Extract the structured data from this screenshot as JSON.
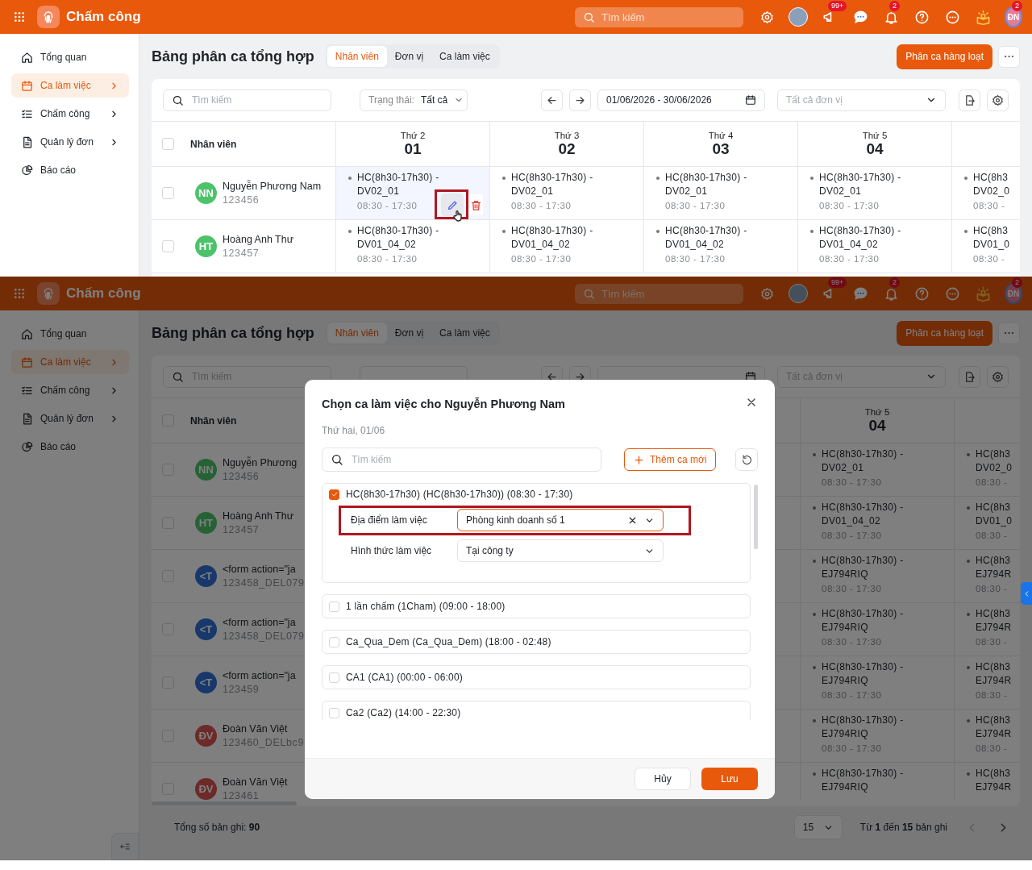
{
  "screens": [
    {
      "header": {
        "app_title": "Chấm công",
        "search_placeholder": "Tìm kiếm",
        "announce_badge": "99+",
        "bell_badge": "2",
        "user_initials": "ĐN",
        "user_badge": "2"
      },
      "sidebar": {
        "items": [
          {
            "label": "Tổng quan",
            "selected": false,
            "submenu": false
          },
          {
            "label": "Ca làm việc",
            "selected": true,
            "submenu": true
          },
          {
            "label": "Chấm công",
            "selected": false,
            "submenu": true
          },
          {
            "label": "Quản lý đơn",
            "selected": false,
            "submenu": true
          },
          {
            "label": "Báo cáo",
            "selected": false,
            "submenu": false
          }
        ]
      },
      "page": {
        "title": "Bảng phân ca tổng hợp",
        "tabs": [
          {
            "label": "Nhân viên",
            "selected": true
          },
          {
            "label": "Đơn vị",
            "selected": false
          },
          {
            "label": "Ca làm việc",
            "selected": false
          }
        ],
        "primary_button": "Phân ca hàng loạt"
      },
      "filters": {
        "search_placeholder": "Tìm kiếm",
        "status_label": "Trạng thái:",
        "status_value": "Tất cả",
        "date_range": "01/06/2026 - 30/06/2026",
        "unit_placeholder": "Tất cả đơn vị"
      },
      "table": {
        "employee_header": "Nhân viên",
        "all_checked": false,
        "day_columns": [
          {
            "weekday": "Thứ 2",
            "date": "01"
          },
          {
            "weekday": "Thứ 3",
            "date": "02"
          },
          {
            "weekday": "Thứ 4",
            "date": "03"
          },
          {
            "weekday": "Thứ 5",
            "date": "04"
          }
        ],
        "rows": [
          {
            "initials": "NN",
            "color": "#4cc36b",
            "checked": false,
            "name": "Nguyễn Phương Nam",
            "code": "123456",
            "shifts": [
              {
                "title": "HC(8h30-17h30) -",
                "unit": "DV02_01",
                "time": "08:30 - 17:30",
                "hovered": true
              },
              {
                "title": "HC(8h30-17h30) -",
                "unit": "DV02_01",
                "time": "08:30 - 17:30",
                "hovered": false
              },
              {
                "title": "HC(8h30-17h30) -",
                "unit": "DV02_01",
                "time": "08:30 - 17:30",
                "hovered": false
              },
              {
                "title": "HC(8h30-17h30) -",
                "unit": "DV02_01",
                "time": "08:30 - 17:30",
                "hovered": false
              },
              {
                "title": "HC(8h3",
                "unit": "DV02_0",
                "time": "08:30 -",
                "hovered": false
              }
            ]
          },
          {
            "initials": "HT",
            "color": "#4cc36b",
            "checked": false,
            "name": "Hoàng Anh Thư",
            "code": "123457",
            "shifts": [
              {
                "title": "HC(8h30-17h30) -",
                "unit": "DV01_04_02",
                "time": "08:30 - 17:30",
                "hovered": false
              },
              {
                "title": "HC(8h30-17h30) -",
                "unit": "DV01_04_02",
                "time": "08:30 - 17:30",
                "hovered": false
              },
              {
                "title": "HC(8h30-17h30) -",
                "unit": "DV01_04_02",
                "time": "08:30 - 17:30",
                "hovered": false
              },
              {
                "title": "HC(8h30-17h30) -",
                "unit": "DV01_04_02",
                "time": "08:30 - 17:30",
                "hovered": false
              },
              {
                "title": "HC(8h3",
                "unit": "DV01_0",
                "time": "08:30 -",
                "hovered": false
              }
            ]
          }
        ]
      }
    },
    {
      "header": {
        "app_title": "Chấm công",
        "search_placeholder": "Tìm kiếm",
        "announce_badge": "99+",
        "bell_badge": "2",
        "user_initials": "ĐN",
        "user_badge": "2"
      },
      "sidebar": {
        "items": [
          {
            "label": "Tổng quan",
            "selected": false,
            "submenu": false
          },
          {
            "label": "Ca làm việc",
            "selected": true,
            "submenu": true
          },
          {
            "label": "Chấm công",
            "selected": false,
            "submenu": true
          },
          {
            "label": "Quản lý đơn",
            "selected": false,
            "submenu": true
          },
          {
            "label": "Báo cáo",
            "selected": false,
            "submenu": false
          }
        ]
      },
      "page": {
        "title": "Bảng phân ca tổng hợp",
        "tabs": [
          {
            "label": "Nhân viên",
            "selected": true
          },
          {
            "label": "Đơn vị",
            "selected": false
          },
          {
            "label": "Ca làm việc",
            "selected": false
          }
        ],
        "primary_button": "Phân ca hàng loạt"
      },
      "filters": {
        "search_placeholder": "Tìm kiếm",
        "unit_placeholder": "Tất cả đơn vị"
      },
      "table": {
        "employee_header": "Nhân viên",
        "all_checked": false,
        "day_columns": [
          {
            "weekday": "Thứ 5",
            "date": "04"
          }
        ],
        "rows": [
          {
            "initials": "NN",
            "color": "#266236",
            "checked": false,
            "name": "Nguyễn Phương",
            "code": "123456",
            "shifts": [
              {
                "title": "HC(8h30-17h30) -",
                "unit": "DV02_01",
                "time": "08:30 - 17:30",
                "hovered": false
              },
              {
                "title": "HC(8h3",
                "unit": "DV02_0",
                "time": "08:30 -",
                "hovered": false
              }
            ]
          },
          {
            "initials": "HT",
            "color": "#266236",
            "checked": false,
            "name": "Hoàng Anh Thư",
            "code": "123457",
            "shifts": [
              {
                "title": "HC(8h30-17h30) -",
                "unit": "DV01_04_02",
                "time": "08:30 - 17:30",
                "hovered": false
              },
              {
                "title": "HC(8h3",
                "unit": "DV01_0",
                "time": "08:30 -",
                "hovered": false
              }
            ]
          },
          {
            "initials": "<T",
            "color": "#18386b",
            "checked": false,
            "name": "<form action=\"ja",
            "code": "123458_DEL079",
            "shifts": [
              {
                "title": "HC(8h30-17h30) -",
                "unit": "EJ794RIQ",
                "time": "08:30 - 17:30",
                "hovered": false
              },
              {
                "title": "HC(8h3",
                "unit": "EJ794R",
                "time": "08:30 -",
                "hovered": false
              }
            ]
          },
          {
            "initials": "<T",
            "color": "#18386b",
            "checked": false,
            "name": "<form action=\"ja",
            "code": "123458_DEL079",
            "shifts": [
              {
                "title": "HC(8h30-17h30) -",
                "unit": "EJ794RIQ",
                "time": "08:30 - 17:30",
                "hovered": false
              },
              {
                "title": "HC(8h3",
                "unit": "EJ794R",
                "time": "08:30 -",
                "hovered": false
              }
            ]
          },
          {
            "initials": "<T",
            "color": "#18386b",
            "checked": false,
            "name": "<form action=\"ja",
            "code": "123459",
            "shifts": [
              {
                "title": "HC(8h30-17h30) -",
                "unit": "EJ794RIQ",
                "time": "08:30 - 17:30",
                "hovered": false
              },
              {
                "title": "HC(8h3",
                "unit": "EJ794R",
                "time": "08:30 -",
                "hovered": false
              }
            ]
          },
          {
            "initials": "ĐV",
            "color": "#6d2a28",
            "checked": false,
            "name": "Đoàn Văn Việt",
            "code": "123460_DELbc9",
            "shifts": [
              {
                "title": "HC(8h30-17h30) -",
                "unit": "EJ794RIQ",
                "time": "08:30 - 17:30",
                "hovered": false
              },
              {
                "title": "HC(8h3",
                "unit": "EJ794R",
                "time": "08:30 -",
                "hovered": false
              }
            ]
          },
          {
            "initials": "ĐV",
            "color": "#6d2a28",
            "checked": false,
            "name": "Đoàn Văn Việt",
            "code": "123461",
            "shifts": [
              {
                "title": "HC(8h30-17h30) -",
                "unit": "EJ794RIQ",
                "hovered": false
              },
              {
                "title": "HC(8h3",
                "unit": "EJ794R",
                "hovered": false
              }
            ]
          }
        ]
      },
      "footer": {
        "total_label": "Tổng số bản ghi:",
        "total": "90",
        "page_size": "15",
        "range": "Từ **1** đến **15** bản ghi"
      },
      "modal": {
        "title": "Chọn ca làm việc cho Nguyễn Phương Nam",
        "subtitle": "Thứ hai, 01/06",
        "search_placeholder": "Tìm kiếm",
        "add_button": "Thêm ca mới",
        "shifts": [
          {
            "label": "HC(8h30-17h30) (HC(8h30-17h30)) (08:30 - 17:30)",
            "checked": true,
            "fields": [
              {
                "label": "Địa điểm làm việc",
                "value": "Phòng kinh doanh số 1",
                "clearable": true,
                "highlighted": true
              },
              {
                "label": "Hình thức làm việc",
                "value": "Tại công ty",
                "clearable": false,
                "highlighted": false
              }
            ]
          },
          {
            "label": "1 lần chấm (1Cham) (09:00 - 18:00)",
            "checked": false
          },
          {
            "label": "Ca_Qua_Dem (Ca_Qua_Dem) (18:00 - 02:48)",
            "checked": false
          },
          {
            "label": "CA1 (CA1) (00:00 - 06:00)",
            "checked": false
          },
          {
            "label": "Ca2 (Ca2) (14:00 - 22:30)",
            "checked": false
          }
        ],
        "cancel_button": "Hủy",
        "save_button": "Lưu"
      }
    }
  ]
}
